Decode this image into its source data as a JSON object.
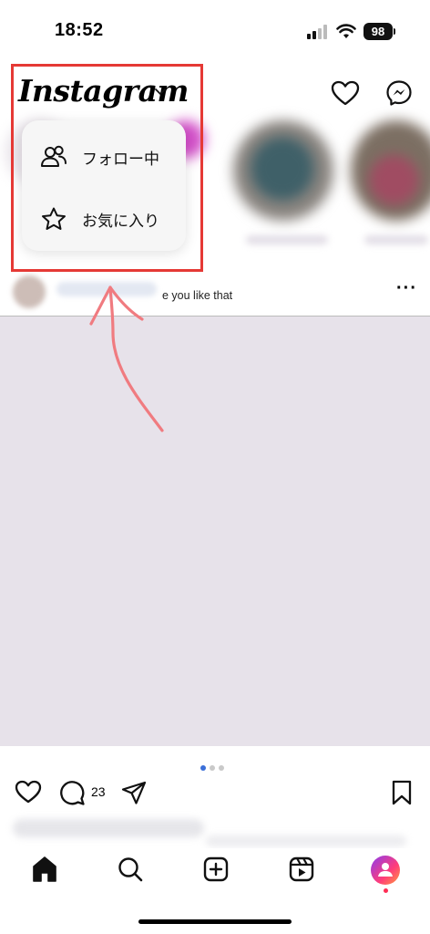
{
  "status_bar": {
    "time": "18:52",
    "battery": "98"
  },
  "header": {
    "logo": "Instagram",
    "icons": [
      "chevron-down-icon",
      "heart-icon",
      "messenger-icon"
    ]
  },
  "menu": {
    "items": [
      {
        "label": "フォロー中",
        "icon": "people-icon"
      },
      {
        "label": "お気に入り",
        "icon": "star-icon"
      }
    ]
  },
  "post": {
    "caption_fragment": "e you like that",
    "comment_count": "23"
  },
  "carousel": {
    "count": 3,
    "active_index": 0
  },
  "tabs": [
    "home-icon",
    "search-icon",
    "create-icon",
    "reels-icon",
    "profile-avatar"
  ],
  "colors": {
    "highlight": "#e53935",
    "arrow": "#f07b80",
    "dot_active": "#3a6fd8"
  }
}
